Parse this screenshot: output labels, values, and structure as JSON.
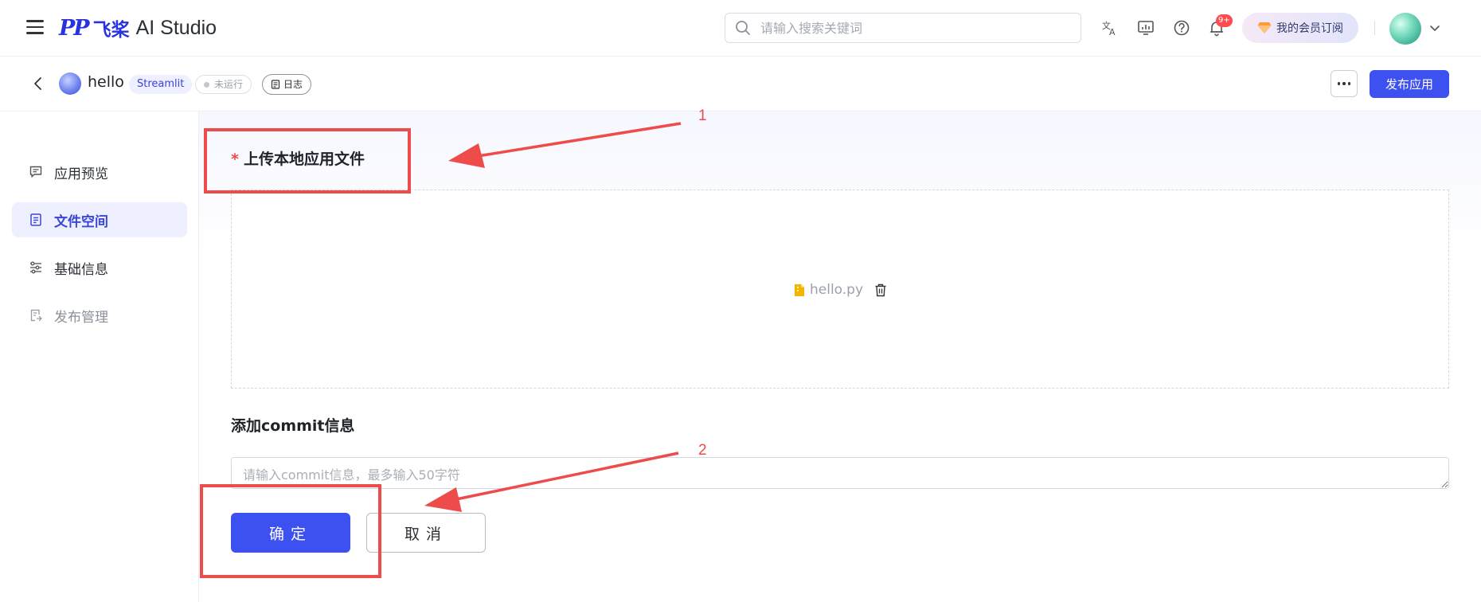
{
  "header": {
    "logo_mark": "PP",
    "logo_cn": "飞桨",
    "logo_en": "AI Studio",
    "search_placeholder": "请输入搜索关键词",
    "notification_badge": "9+",
    "member_label": "我的会员订阅"
  },
  "subheader": {
    "app_name": "hello",
    "framework_tag": "Streamlit",
    "status_tag": "未运行",
    "log_tag": "日志",
    "publish_label": "发布应用"
  },
  "sidebar": {
    "items": [
      {
        "label": "应用预览",
        "icon": "preview-icon",
        "state": "normal"
      },
      {
        "label": "文件空间",
        "icon": "file-space-icon",
        "state": "active"
      },
      {
        "label": "基础信息",
        "icon": "settings-sliders-icon",
        "state": "normal"
      },
      {
        "label": "发布管理",
        "icon": "publish-manage-icon",
        "state": "disabled"
      }
    ]
  },
  "main": {
    "upload_required_mark": "*",
    "upload_label": "上传本地应用文件",
    "file_name": "hello.py",
    "commit_label": "添加commit信息",
    "commit_placeholder": "请输入commit信息，最多输入50字符",
    "commit_value": "",
    "confirm_label": "确定",
    "cancel_label": "取消"
  },
  "annotations": {
    "label_1": "1",
    "label_2": "2",
    "color": "#ee4b4b"
  },
  "colors": {
    "brand": "#2932e1",
    "primary_button": "#3d50f0",
    "active_nav_bg": "#eef0ff"
  }
}
